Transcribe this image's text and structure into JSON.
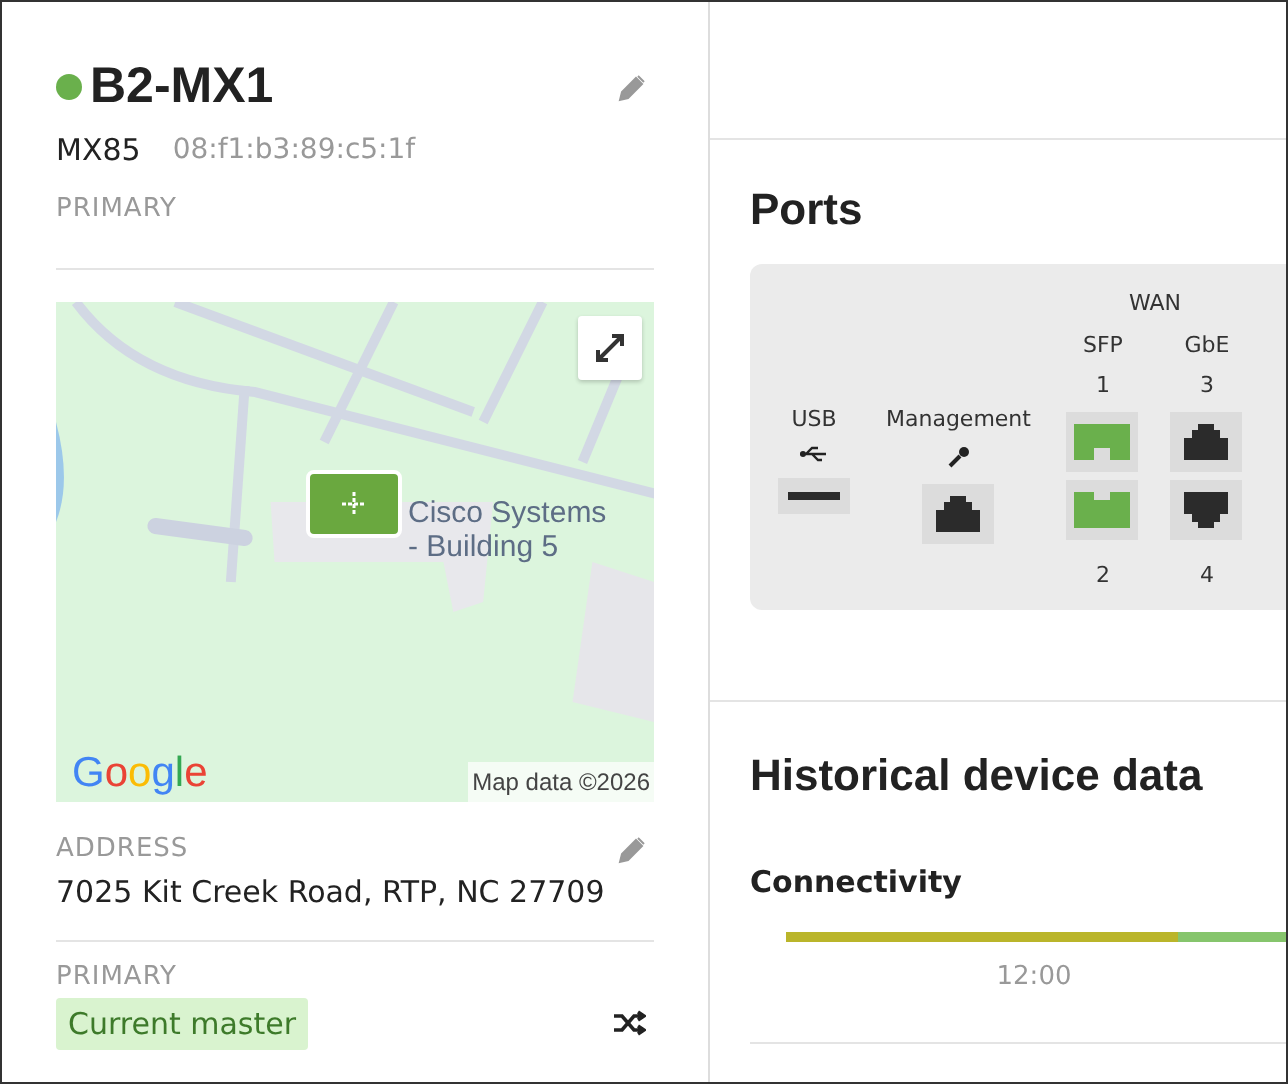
{
  "device": {
    "name": "B2-MX1",
    "online": true,
    "model": "MX85",
    "mac": "08:f1:b3:89:c5:1f",
    "role": "PRIMARY"
  },
  "map": {
    "place_label": [
      "Cisco Systems",
      "- Building 5"
    ],
    "logo": "Google",
    "attribution": "Map data ©2026"
  },
  "address": {
    "label": "ADDRESS",
    "value": "7025 Kit Creek Road, RTP, NC 27709"
  },
  "primary": {
    "label": "PRIMARY",
    "badge": "Current master"
  },
  "ports": {
    "title": "Ports",
    "groups": [
      {
        "label": "USB",
        "kind": "usb",
        "ports": [
          {
            "kind": "usb",
            "active": false
          }
        ]
      },
      {
        "label": "Management",
        "kind": "management",
        "ports": [
          {
            "kind": "rj45",
            "active": false
          }
        ]
      },
      {
        "label": "WAN",
        "kind": "wan",
        "columns": [
          {
            "label": "SFP",
            "ports": [
              {
                "number": "1",
                "kind": "sfp",
                "active": true
              },
              {
                "number": "2",
                "kind": "sfp",
                "active": true
              }
            ]
          },
          {
            "label": "GbE",
            "ports": [
              {
                "number": "3",
                "kind": "rj45",
                "active": false
              },
              {
                "number": "4",
                "kind": "rj45",
                "active": false
              }
            ]
          }
        ]
      }
    ]
  },
  "history": {
    "title": "Historical device data",
    "section": "Connectivity",
    "time_label": "12:00"
  }
}
